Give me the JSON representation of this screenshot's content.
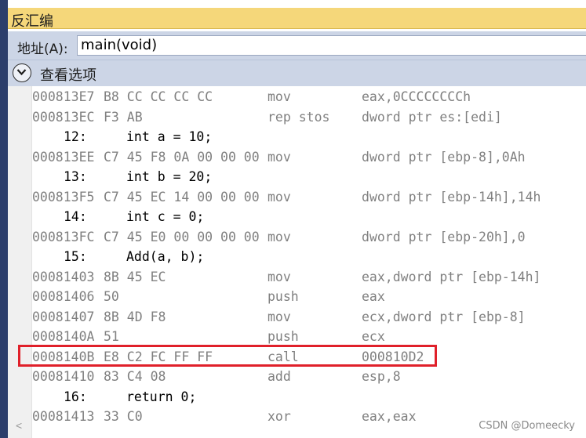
{
  "window": {
    "title": "反汇编"
  },
  "address": {
    "label": "地址(A):",
    "value": "main(void)"
  },
  "options": {
    "label": "查看选项"
  },
  "rows": [
    {
      "kind": "asm",
      "addr": "000813E7",
      "bytes": "B8 CC CC CC CC",
      "op": "mov",
      "args": "eax,0CCCCCCCCh"
    },
    {
      "kind": "asm",
      "addr": "000813EC",
      "bytes": "F3 AB",
      "op": "rep stos",
      "args": "dword ptr es:[edi]"
    },
    {
      "kind": "src",
      "num": "12:",
      "text": "int a = 10;"
    },
    {
      "kind": "asm",
      "addr": "000813EE",
      "bytes": "C7 45 F8 0A 00 00 00",
      "op": "mov",
      "args": "dword ptr [ebp-8],0Ah"
    },
    {
      "kind": "src",
      "num": "13:",
      "text": "int b = 20;"
    },
    {
      "kind": "asm",
      "addr": "000813F5",
      "bytes": "C7 45 EC 14 00 00 00",
      "op": "mov",
      "args": "dword ptr [ebp-14h],14h"
    },
    {
      "kind": "src",
      "num": "14:",
      "text": "int c = 0;"
    },
    {
      "kind": "asm",
      "addr": "000813FC",
      "bytes": "C7 45 E0 00 00 00 00",
      "op": "mov",
      "args": "dword ptr [ebp-20h],0"
    },
    {
      "kind": "src",
      "num": "15:",
      "text": "Add(a, b);"
    },
    {
      "kind": "asm",
      "addr": "00081403",
      "bytes": "8B 45 EC",
      "op": "mov",
      "args": "eax,dword ptr [ebp-14h]"
    },
    {
      "kind": "asm",
      "addr": "00081406",
      "bytes": "50",
      "op": "push",
      "args": "eax"
    },
    {
      "kind": "asm",
      "addr": "00081407",
      "bytes": "8B 4D F8",
      "op": "mov",
      "args": "ecx,dword ptr [ebp-8]"
    },
    {
      "kind": "asm",
      "addr": "0008140A",
      "bytes": "51",
      "op": "push",
      "args": "ecx"
    },
    {
      "kind": "asm",
      "addr": "0008140B",
      "bytes": "E8 C2 FC FF FF",
      "op": "call",
      "args": "000810D2"
    },
    {
      "kind": "asm",
      "addr": "00081410",
      "bytes": "83 C4 08",
      "op": "add",
      "args": "esp,8"
    },
    {
      "kind": "src",
      "num": "16:",
      "text": "return 0;"
    },
    {
      "kind": "asm",
      "addr": "00081413",
      "bytes": "33 C0",
      "op": "xor",
      "args": "eax,eax"
    }
  ],
  "scroll": {
    "arrow": "<"
  },
  "watermark": "CSDN @Domeecky",
  "colors": {
    "title_bg": "#f5d77a",
    "bar_bg": "#ccd5e6",
    "highlight_box": "#e0202a",
    "asm_text": "#808080",
    "src_text": "#000000"
  }
}
